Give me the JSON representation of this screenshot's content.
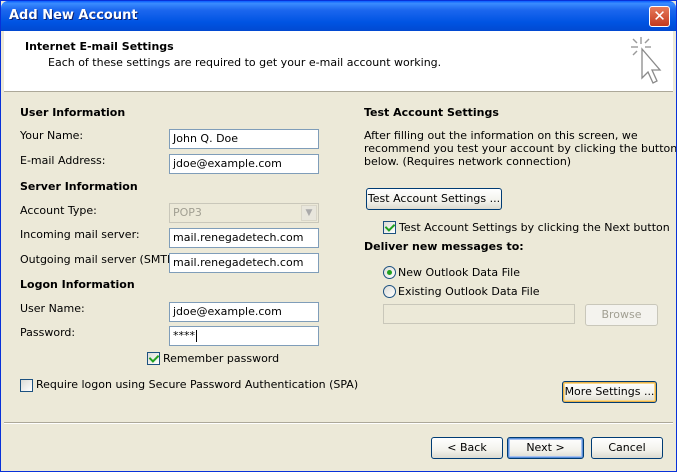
{
  "window": {
    "title": "Add New Account",
    "close_glyph": "✕"
  },
  "header": {
    "title": "Internet E-mail Settings",
    "subtitle": "Each of these settings are required to get your e-mail account working."
  },
  "user_info": {
    "heading": "User Information",
    "name_label": "Your Name:",
    "name_value": "John Q. Doe",
    "email_label": "E-mail Address:",
    "email_value": "jdoe@example.com"
  },
  "server_info": {
    "heading": "Server Information",
    "account_type_label": "Account Type:",
    "account_type_value": "POP3",
    "incoming_label": "Incoming mail server:",
    "incoming_value": "mail.renegadetech.com",
    "outgoing_label": "Outgoing mail server (SMTP):",
    "outgoing_value": "mail.renegadetech.com"
  },
  "logon_info": {
    "heading": "Logon Information",
    "username_label": "User Name:",
    "username_value": "jdoe@example.com",
    "password_label": "Password:",
    "password_value": "****",
    "remember_label": "Remember password",
    "remember_checked": true,
    "spa_label": "Require logon using Secure Password Authentication (SPA)",
    "spa_checked": false
  },
  "test_settings": {
    "heading": "Test Account Settings",
    "description": "After filling out the information on this screen, we recommend you test your account by clicking the button below. (Requires network connection)",
    "description_lines": [
      "After filling out the information on this screen, we",
      "recommend you test your account by clicking the button",
      "below. (Requires network connection)"
    ],
    "test_button": "Test Account Settings ...",
    "test_on_next_label": "Test Account Settings by clicking the Next button",
    "test_on_next_checked": true
  },
  "deliver": {
    "heading": "Deliver new messages to:",
    "options": [
      "New Outlook Data File",
      "Existing Outlook Data File"
    ],
    "selected": "New Outlook Data File",
    "existing_file_value": "",
    "browse_button": "Browse"
  },
  "buttons": {
    "more_settings": "More Settings ...",
    "back": "< Back",
    "next": "Next >",
    "cancel": "Cancel"
  },
  "colors": {
    "titlebar": "#0054e3",
    "dialog_bg": "#ece9d8",
    "check_green": "#21a121"
  },
  "icons": {
    "header": "cursor-sparkle-icon",
    "close": "close-icon",
    "dropdown": "chevron-down-icon"
  }
}
